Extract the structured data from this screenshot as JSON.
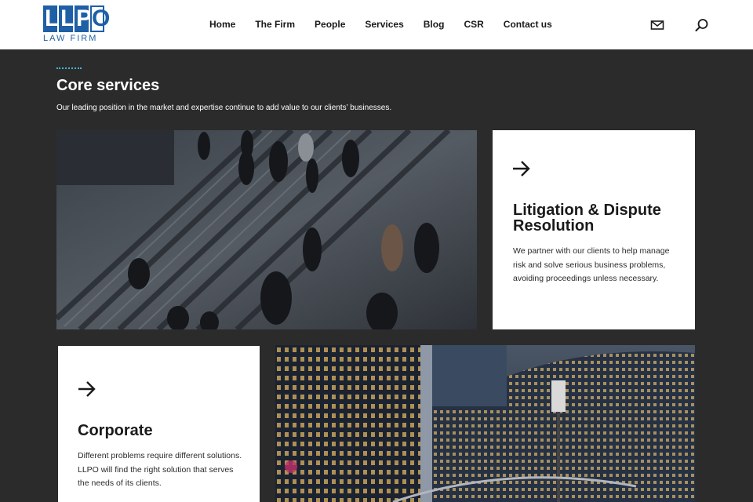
{
  "header": {
    "logo_letters": [
      "L",
      "L",
      "P",
      "O"
    ],
    "logo_sub": "LAW FIRM",
    "nav": [
      "Home",
      "The Firm",
      "People",
      "Services",
      "Blog",
      "CSR",
      "Contact us"
    ],
    "icons": [
      "mail-icon",
      "search-icon"
    ],
    "accent": "#1f5fa6"
  },
  "section": {
    "title": "Core services",
    "subtitle": "Our leading position in the market and expertise continue to add value to our clients’ businesses.",
    "dots_color": "#3fb6d6",
    "background": "#2b2b2b"
  },
  "cards": [
    {
      "icon": "arrow-right-icon",
      "title": "Litigation & Dispute Resolution",
      "text": "We partner with our clients to help manage risk and solve serious business problems, avoiding proceedings unless necessary."
    },
    {
      "icon": "arrow-right-icon",
      "title": "Corporate",
      "text": "Different problems require different solutions. LLPO will find the right solution that serves the needs of its clients."
    }
  ]
}
